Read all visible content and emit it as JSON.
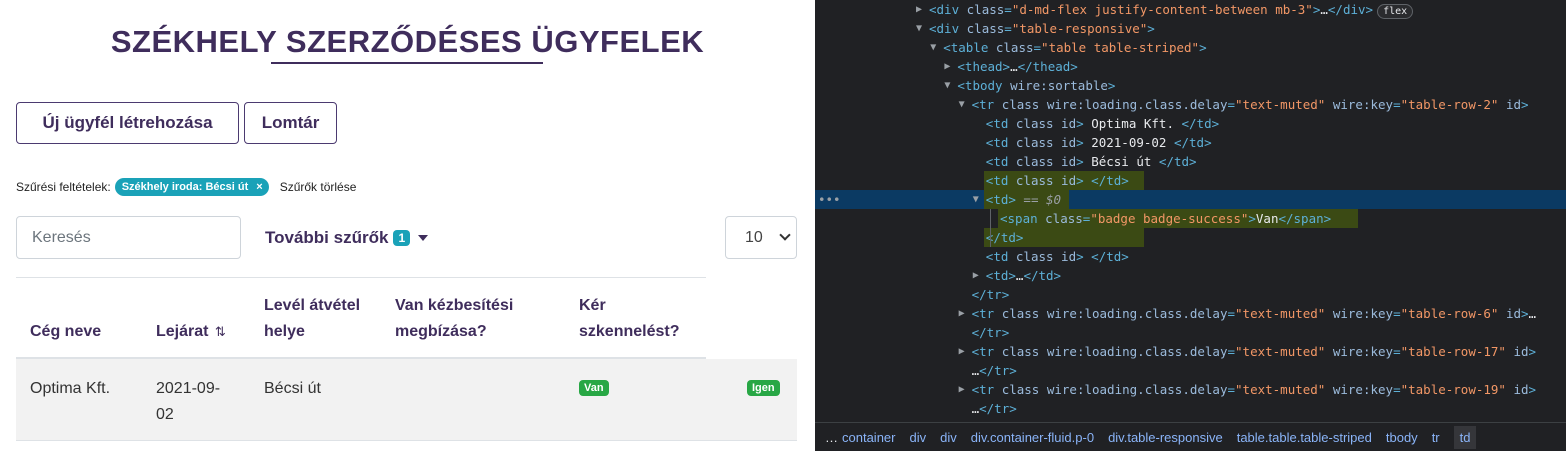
{
  "app": {
    "title": "SZÉKHELY SZERZŐDÉSES ÜGYFELEK",
    "buttons": {
      "new_client": "Új ügyfél létrehozása",
      "trash": "Lomtár"
    },
    "filters": {
      "label": "Szűrési feltételek:",
      "chip": "Székhely iroda: Bécsi út",
      "chip_close": "×",
      "clear": "Szűrők törlése"
    },
    "search": {
      "placeholder": "Keresés",
      "value": ""
    },
    "more_filters": {
      "label": "További szűrők",
      "count": "1"
    },
    "page_size": {
      "selected": "10"
    },
    "table": {
      "headers": {
        "company": "Cég neve",
        "expiry": "Lejárat",
        "expiry_sort_icon": "⇅",
        "mail_line1": "Levél átvétel",
        "mail_line2": "helye",
        "delivery_line1": "Van kézbesítési",
        "delivery_line2": "megbízása?",
        "scan_line1": "Kér",
        "scan_line2": "szkennelést?"
      },
      "rows": [
        {
          "company": "Optima Kft.",
          "expiry_line1": "2021-09-",
          "expiry_line2": "02",
          "mail_place": "Bécsi út",
          "delivery": "",
          "scan": "Van",
          "extra": "Igen"
        }
      ]
    }
  },
  "devtools": {
    "lines": [
      {
        "indent": 0,
        "tri": "▶",
        "parts": [
          [
            "tag",
            "<div "
          ],
          [
            "attr",
            "class"
          ],
          [
            "tag",
            "="
          ],
          [
            "val",
            "\"d-md-flex justify-content-between mb-3\""
          ],
          [
            "tag",
            ">"
          ],
          [
            "txt",
            "…"
          ],
          [
            "tag",
            "</div>"
          ]
        ],
        "badge": "flex"
      },
      {
        "indent": 0,
        "tri": "▼",
        "parts": [
          [
            "tag",
            "<div "
          ],
          [
            "attr",
            "class"
          ],
          [
            "tag",
            "="
          ],
          [
            "val",
            "\"table-responsive\""
          ],
          [
            "tag",
            ">"
          ]
        ]
      },
      {
        "indent": 1,
        "tri": "▼",
        "parts": [
          [
            "tag",
            "<table "
          ],
          [
            "attr",
            "class"
          ],
          [
            "tag",
            "="
          ],
          [
            "val",
            "\"table table-striped\""
          ],
          [
            "tag",
            ">"
          ]
        ]
      },
      {
        "indent": 2,
        "tri": "▶",
        "parts": [
          [
            "tag",
            "<thead>"
          ],
          [
            "txt",
            "…"
          ],
          [
            "tag",
            "</thead>"
          ]
        ]
      },
      {
        "indent": 2,
        "tri": "▼",
        "parts": [
          [
            "tag",
            "<tbody "
          ],
          [
            "attr",
            "wire:sortable"
          ],
          [
            "tag",
            ">"
          ]
        ]
      },
      {
        "indent": 3,
        "tri": "▼",
        "parts": [
          [
            "tag",
            "<tr "
          ],
          [
            "attr",
            "class wire:loading.class.delay"
          ],
          [
            "tag",
            "="
          ],
          [
            "val",
            "\"text-muted\""
          ],
          [
            "attr",
            " wire:key"
          ],
          [
            "tag",
            "="
          ],
          [
            "val",
            "\"table-row-2\""
          ],
          [
            "attr",
            " id"
          ],
          [
            "tag",
            ">"
          ]
        ]
      },
      {
        "indent": 4,
        "tri": "",
        "parts": [
          [
            "tag",
            "<td "
          ],
          [
            "attr",
            "class id"
          ],
          [
            "tag",
            "> "
          ],
          [
            "txt",
            "Optima Kft. "
          ],
          [
            "tag",
            "</td>"
          ]
        ]
      },
      {
        "indent": 4,
        "tri": "",
        "parts": [
          [
            "tag",
            "<td "
          ],
          [
            "attr",
            "class id"
          ],
          [
            "tag",
            "> "
          ],
          [
            "txt",
            "2021-09-02 "
          ],
          [
            "tag",
            "</td>"
          ]
        ]
      },
      {
        "indent": 4,
        "tri": "",
        "parts": [
          [
            "tag",
            "<td "
          ],
          [
            "attr",
            "class id"
          ],
          [
            "tag",
            "> "
          ],
          [
            "txt",
            "Bécsi út "
          ],
          [
            "tag",
            "</td>"
          ]
        ]
      },
      {
        "indent": 4,
        "tri": "",
        "parts": [
          [
            "tag",
            "<td "
          ],
          [
            "attr",
            "class id"
          ],
          [
            "tag",
            "> </td>"
          ]
        ]
      },
      {
        "indent": 4,
        "tri": "▼",
        "parts": [
          [
            "tag",
            "<td>"
          ],
          [
            "ref",
            " == $0"
          ]
        ]
      },
      {
        "indent": 5,
        "tri": "",
        "parts": [
          [
            "tag",
            "<span "
          ],
          [
            "attr",
            "class"
          ],
          [
            "tag",
            "="
          ],
          [
            "val",
            "\"badge badge-success\""
          ],
          [
            "tag",
            ">"
          ],
          [
            "txt",
            "Van"
          ],
          [
            "tag",
            "</span>"
          ]
        ]
      },
      {
        "indent": 4,
        "tri": "",
        "parts": [
          [
            "tag",
            "</td>"
          ]
        ]
      },
      {
        "indent": 4,
        "tri": "",
        "parts": [
          [
            "tag",
            "<td "
          ],
          [
            "attr",
            "class id"
          ],
          [
            "tag",
            "> </td>"
          ]
        ]
      },
      {
        "indent": 4,
        "tri": "▶",
        "parts": [
          [
            "tag",
            "<td>"
          ],
          [
            "txt",
            "…"
          ],
          [
            "tag",
            "</td>"
          ]
        ]
      },
      {
        "indent": 3,
        "tri": "",
        "parts": [
          [
            "tag",
            "</tr>"
          ]
        ]
      },
      {
        "indent": 3,
        "tri": "▶",
        "parts": [
          [
            "tag",
            "<tr "
          ],
          [
            "attr",
            "class wire:loading.class.delay"
          ],
          [
            "tag",
            "="
          ],
          [
            "val",
            "\"text-muted\""
          ],
          [
            "attr",
            " wire:key"
          ],
          [
            "tag",
            "="
          ],
          [
            "val",
            "\"table-row-6\""
          ],
          [
            "attr",
            " id"
          ],
          [
            "tag",
            ">"
          ],
          [
            "txt",
            "…"
          ]
        ]
      },
      {
        "indent": 3,
        "tri": "",
        "parts": [
          [
            "tag",
            "</tr>"
          ]
        ]
      },
      {
        "indent": 3,
        "tri": "▶",
        "parts": [
          [
            "tag",
            "<tr "
          ],
          [
            "attr",
            "class wire:loading.class.delay"
          ],
          [
            "tag",
            "="
          ],
          [
            "val",
            "\"text-muted\""
          ],
          [
            "attr",
            " wire:key"
          ],
          [
            "tag",
            "="
          ],
          [
            "val",
            "\"table-row-17\""
          ],
          [
            "attr",
            " id"
          ],
          [
            "tag",
            ">"
          ]
        ]
      },
      {
        "indent": 3,
        "tri": "",
        "parts": [
          [
            "txt",
            "…"
          ],
          [
            "tag",
            "</tr>"
          ]
        ]
      },
      {
        "indent": 3,
        "tri": "▶",
        "parts": [
          [
            "tag",
            "<tr "
          ],
          [
            "attr",
            "class wire:loading.class.delay"
          ],
          [
            "tag",
            "="
          ],
          [
            "val",
            "\"text-muted\""
          ],
          [
            "attr",
            " wire:key"
          ],
          [
            "tag",
            "="
          ],
          [
            "val",
            "\"table-row-19\""
          ],
          [
            "attr",
            " id"
          ],
          [
            "tag",
            ">"
          ]
        ]
      },
      {
        "indent": 3,
        "tri": "",
        "parts": [
          [
            "txt",
            "…"
          ],
          [
            "tag",
            "</tr>"
          ]
        ]
      }
    ],
    "gutter_dots": "•••",
    "breadcrumb": {
      "dots": "…",
      "items": [
        "container",
        "div",
        "div",
        "div.container-fluid.p-0",
        "div.table-responsive",
        "table.table.table-striped",
        "tbody",
        "tr",
        "td"
      ]
    }
  }
}
